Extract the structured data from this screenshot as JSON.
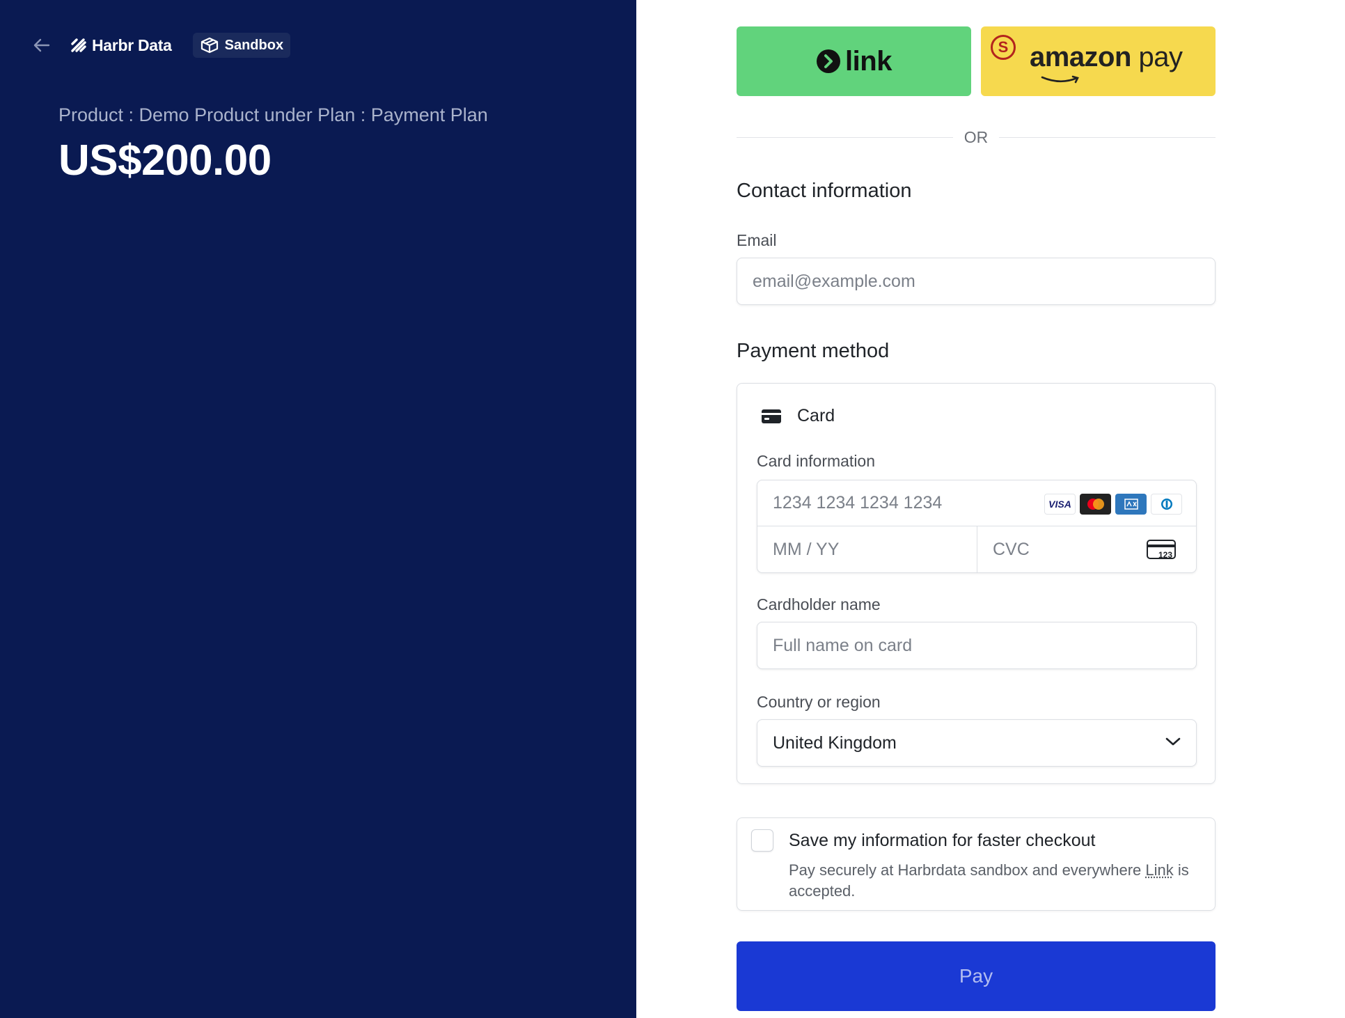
{
  "header": {
    "brand_name": "Harbr Data",
    "environment_badge": "Sandbox"
  },
  "summary": {
    "product_line": "Product : Demo Product under Plan : Payment Plan",
    "amount": "US$200.00"
  },
  "express_checkout": {
    "link_label": "link",
    "amazon_label_bold": "amazon",
    "amazon_label_rest": " pay",
    "amazon_mark": "S",
    "divider_text": "OR"
  },
  "contact": {
    "heading": "Contact information",
    "email_label": "Email",
    "email_placeholder": "email@example.com"
  },
  "payment": {
    "heading": "Payment method",
    "method_tab": "Card",
    "card_info_label": "Card information",
    "card_number_placeholder": "1234 1234 1234 1234",
    "expiry_placeholder": "MM / YY",
    "cvc_placeholder": "CVC",
    "cvc_icon_text": "123",
    "card_brands": [
      "VISA",
      "mastercard",
      "amex",
      "diners"
    ],
    "cardholder_label": "Cardholder name",
    "cardholder_placeholder": "Full name on card",
    "country_label": "Country or region",
    "country_value": "United Kingdom"
  },
  "save_info": {
    "title": "Save my information for faster checkout",
    "desc_before": "Pay securely at Harbrdata sandbox and everywhere ",
    "desc_link": "Link",
    "desc_after": " is accepted.",
    "checked": false
  },
  "pay_button": {
    "label": "Pay"
  },
  "colors": {
    "left_panel_bg": "#0a1a52",
    "link_green": "#61d37c",
    "amazon_yellow": "#f6d94e",
    "pay_blue": "#1a39d4"
  }
}
